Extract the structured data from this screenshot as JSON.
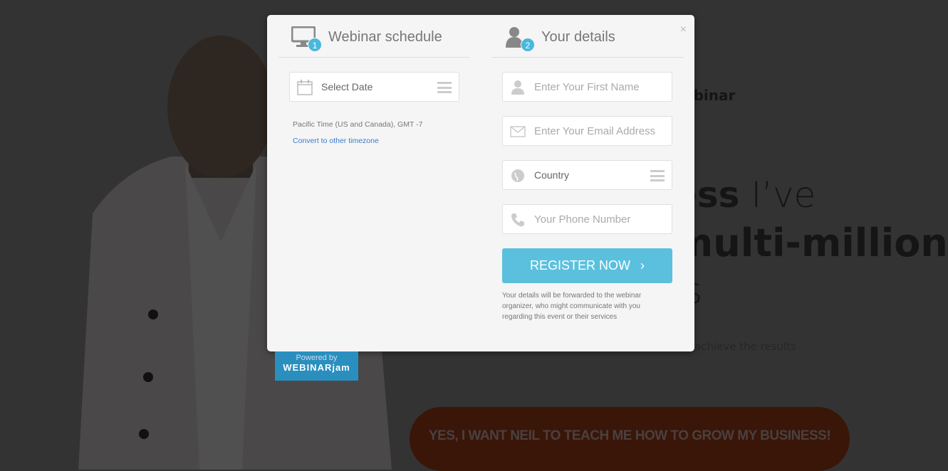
{
  "background": {
    "headline_fragment_1": "ebinar",
    "headline_bold_2": "ess",
    "headline_light_2": " I’ve",
    "headline_bold_3": "multi-million",
    "headline_light_4": "s",
    "subtext_fragment": "achieve the results",
    "cta_label": "YES, I WANT NEIL TO TEACH ME HOW TO GROW MY BUSINESS!"
  },
  "modal": {
    "close_label": "×",
    "schedule": {
      "step": "1",
      "title": "Webinar schedule",
      "select_date": "Select Date",
      "timezone": "Pacific Time (US and Canada), GMT -7",
      "convert_link": "Convert to other timezone"
    },
    "details": {
      "step": "2",
      "title": "Your details",
      "first_name_placeholder": "Enter Your First Name",
      "email_placeholder": "Enter Your Email Address",
      "country": "Country",
      "phone_placeholder": "Your Phone Number",
      "register_label": "REGISTER NOW",
      "register_icon": "chevron-right",
      "disclaimer": "Your details will be forwarded to the webinar organizer, who might communicate with you regarding this event or their services"
    }
  },
  "powered": {
    "line1": "Powered by",
    "line2": "WEBINARjam"
  },
  "colors": {
    "accent": "#5bc0de",
    "badge": "#4ab7dc",
    "overlay": "#333333",
    "link": "#3a7bc8"
  }
}
